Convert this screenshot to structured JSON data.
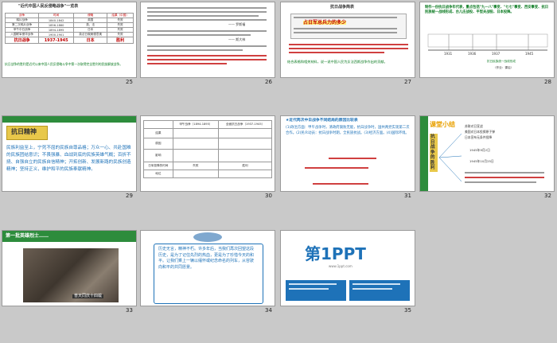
{
  "slides": [
    {
      "num": "25",
      "title": "\"近代中国人民反侵略战争\"一览表",
      "headers": [
        "战争",
        "时间",
        "侵略",
        "结果（中国）"
      ],
      "rows": [
        [
          "鸦片战争",
          "1840-1842",
          "英国",
          "失败"
        ],
        [
          "第二次鸦片战争",
          "1856-1860",
          "英、法",
          "失败"
        ],
        [
          "甲午中日战争",
          "1894-1895",
          "日本",
          "失败"
        ],
        [
          "八国联军侵华战争",
          "1900-1901",
          "英法日俄美德意奥",
          "失败"
        ],
        [
          "抗日战争",
          "1937-1945",
          "日本",
          "胜利"
        ]
      ],
      "footer": "抗日战争的胜利是近代以来中国人民反侵略斗争中第一次取得完全胜利的民族解放战争。"
    },
    {
      "num": "26",
      "body": "中国是抗击日本法西斯侵略的主战场。抗战中中国军民付出了巨大牺牲。",
      "quote": "—— 罗斯福",
      "quote2": "—— 斯大林"
    },
    {
      "num": "27",
      "title": "抗日战争简表",
      "highlight": "占日军总兵力的多少",
      "footer": "结合表格和相关材料，说一说中国人民为反法西斯战争作出的贡献。"
    },
    {
      "num": "28",
      "title": "制作一份抗日战争年代表，重点包括\"九一八\"事变、\"七七\"事变、西安事变、抗日民族统一战线形成、台儿庄战役、平型关战役、日本投降。",
      "years": [
        "1931",
        "1936",
        "1937",
        "1938",
        "1945"
      ],
      "note": "抗日民族统一战线形成",
      "legend": "（作业：课后）"
    },
    {
      "num": "29",
      "title": "抗日精神",
      "body": "民族利益至上，宁死不屈的民族自尊品格；万众一心、共赴国难的民族团结意识；不畏强暴、血战到底的民族英雄气概；百折不挠、自强自立的民族自信精神；开拓创新、发展新路的民族创造精神；坚持正义，维护和平的民族奉献精神。"
    },
    {
      "num": "30",
      "headers": [
        "甲午战争（1894-1895）",
        "全面抗日战争（1937-1945）"
      ],
      "rows": [
        "结果",
        "原因",
        "影响",
        "日军投降的时间",
        "地位"
      ],
      "footer": [
        "失败",
        "胜利"
      ]
    },
    {
      "num": "31",
      "title": "★近代两次中日战争不同结局的原因比较表",
      "body": "(1)政治方面：甲午战争时，清政府腐败无能，抗日战争时，国共两党实现第二次合作。(2)民众动员：抗日战争时期，全民族抗战。(3)经济方面。(4)国际环境。"
    },
    {
      "num": "32",
      "side": "课堂小结",
      "vtitle": "抗日战争的胜利",
      "items": [
        "苏联对日宣战",
        "美国对日本投掷原子弹",
        "日本宣布无条件投降",
        "1945年9月2日",
        "1945年10月25日"
      ]
    },
    {
      "num": "33",
      "title": "第一批英雄烈士……",
      "caption": "普天同庆十四载"
    },
    {
      "num": "34",
      "body": "历史无言，精神不朽。许多年后，当我们再次回望这段历史，是为了记住先烈的热血，更是为了珍惜今天的和平。让我们乘上一辆以缅怀或纪念命名的列车，从容驶向和平的共同愿景。"
    },
    {
      "num": "35",
      "logo_main": "第1PPT",
      "logo_sub": "www.1ppt.com"
    }
  ],
  "colors": {
    "green": "#2d8c3c",
    "yellow": "#e8c84a",
    "red": "#c00000",
    "blue": "#1e72b8"
  }
}
